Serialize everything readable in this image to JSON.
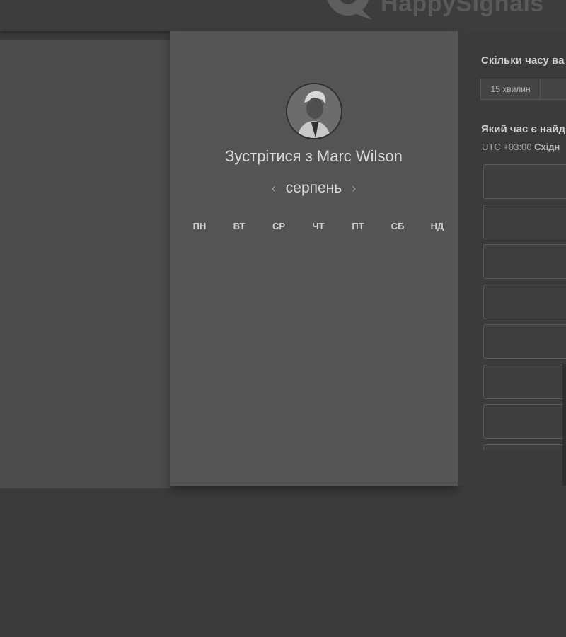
{
  "header": {
    "brand_name": "HappySignals"
  },
  "scheduler": {
    "title": "Зустрітися з Marc Wilson",
    "month": "серпень",
    "weekdays": [
      "ПН",
      "ВТ",
      "СР",
      "ЧТ",
      "ПТ",
      "СБ",
      "НД"
    ]
  },
  "right_panel": {
    "duration_question": "Скільки часу ва",
    "durations": [
      "15 хвилин",
      ""
    ],
    "time_question": "Який час є найд",
    "timezone_prefix": "UTC +03:00 ",
    "timezone_name": "Східн",
    "slot_count": 8
  },
  "colors": {
    "background": "#3b3b3b",
    "card": "#545454",
    "text_light": "#d9d9d9"
  }
}
